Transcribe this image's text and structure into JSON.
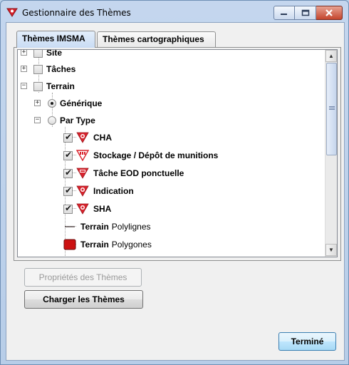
{
  "window": {
    "title": "Gestionnaire des Thèmes"
  },
  "tabs": [
    {
      "label": "Thèmes IMSMA",
      "active": true
    },
    {
      "label": "Thèmes cartographiques",
      "active": false
    }
  ],
  "tree": {
    "items": [
      {
        "label": "Site",
        "control": "checkbox",
        "checked": false,
        "expander": "+"
      },
      {
        "label": "Tâches",
        "control": "checkbox",
        "checked": false,
        "expander": "+"
      },
      {
        "label": "Terrain",
        "control": "checkbox",
        "checked": false,
        "expander": "-"
      },
      {
        "label": "Générique",
        "control": "radio",
        "selected": true,
        "expander": "+"
      },
      {
        "label": "Par Type",
        "control": "radio",
        "selected": false,
        "expander": "-"
      },
      {
        "label": "CHA",
        "control": "checkbox",
        "checked": true,
        "icon": "hazard-triangle-icon"
      },
      {
        "label": "Stockage / Dépôt de munitions",
        "control": "checkbox",
        "checked": true,
        "icon": "ammo-triangle-icon"
      },
      {
        "label": "Tâche EOD ponctuelle",
        "control": "checkbox",
        "checked": true,
        "icon": "eod-triangle-icon"
      },
      {
        "label": "Indication",
        "control": "checkbox",
        "checked": true,
        "icon": "hazard-triangle-icon"
      },
      {
        "label": "SHA",
        "control": "checkbox",
        "checked": true,
        "icon": "hazard-triangle-icon"
      },
      {
        "label_bold": "Terrain",
        "label_rest": "Polylignes",
        "icon": "line-legend-icon"
      },
      {
        "label_bold": "Terrain",
        "label_rest": "Polygones",
        "icon": "polygon-legend-icon"
      }
    ]
  },
  "buttons": {
    "properties": "Propriétés des Thèmes",
    "load": "Charger les Thèmes",
    "done": "Terminé"
  },
  "colors": {
    "hazard_red": "#d9232d",
    "polygon_red": "#cc1111"
  }
}
